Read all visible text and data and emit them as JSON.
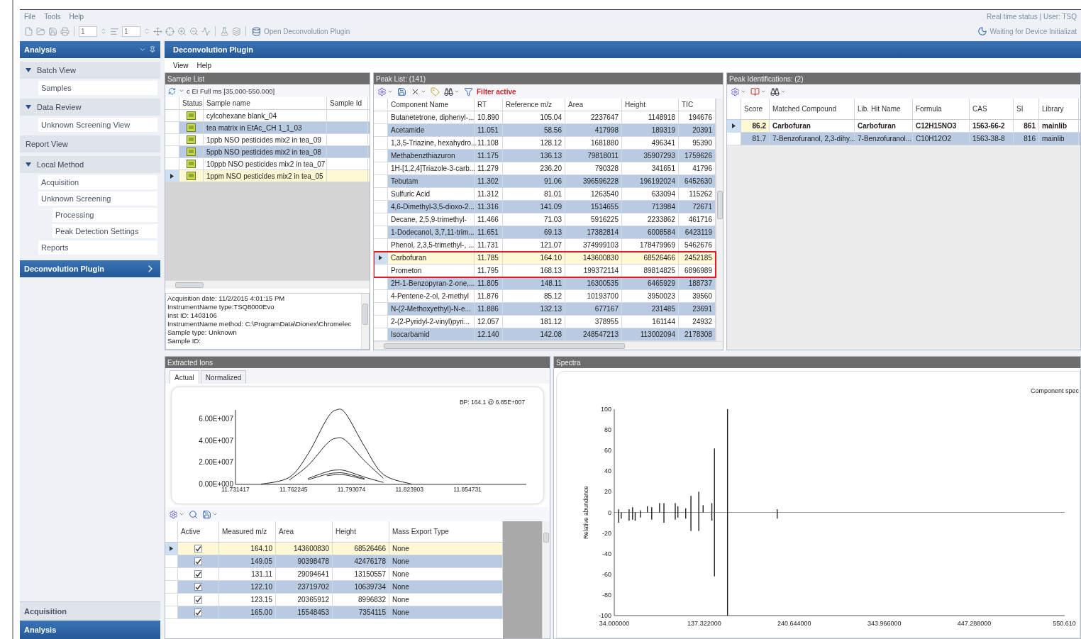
{
  "menu": [
    "File",
    "Tools",
    "Help"
  ],
  "status": {
    "text": "Real time status | User: TSQ",
    "device": "Waiting for Device Initializat"
  },
  "toolbar": {
    "spinners": [
      "1",
      "1"
    ],
    "plugin_button": "Open Deconvolution Plugin"
  },
  "sidebar": {
    "title": "Analysis",
    "items": [
      {
        "label": "Batch View",
        "expanded": true,
        "children": [
          {
            "label": "Samples"
          }
        ]
      },
      {
        "label": "Data Review",
        "expanded": true,
        "children": [
          {
            "label": "Unknown Screening View"
          }
        ]
      },
      {
        "label": "Report View"
      },
      {
        "label": "Local Method",
        "expanded": true,
        "children": [
          {
            "label": "Acquisition"
          },
          {
            "label": "Unknown Screening",
            "children": [
              {
                "label": "Processing"
              },
              {
                "label": "Peak Detection Settings"
              }
            ]
          },
          {
            "label": "Reports"
          }
        ]
      }
    ],
    "plugin_bar": "Deconvolution Plugin",
    "bottom_nav": [
      {
        "label": "Acquisition",
        "selected": false
      },
      {
        "label": "Analysis",
        "selected": true
      }
    ]
  },
  "plugin": {
    "title": "Deconvolution Plugin",
    "menu": [
      "View",
      "Help"
    ]
  },
  "sample_list": {
    "title": "Sample List",
    "scan_filter": "c EI Full ms [35.000-550.000]",
    "columns": [
      "Status",
      "Sample name",
      "Sample Id"
    ],
    "rows": [
      {
        "name": "cylcohexane blank_04",
        "selected": false
      },
      {
        "name": "tea matrix in EtAc_CH 1_1_03",
        "selected": false
      },
      {
        "name": "1ppb NSO pesticides mix2 in tea_09",
        "selected": false
      },
      {
        "name": "5ppb NSO pesticides mix2 in tea_08",
        "selected": false
      },
      {
        "name": "10ppb NSO pesticides mix2 in tea_07",
        "selected": false
      },
      {
        "name": "1ppm NSO pesticides mix2 in tea_05",
        "selected": true
      }
    ],
    "info": [
      "Acquisition date: 11/2/2015 4:01:15 PM",
      "InstrumentName type:TSQ8000Evo",
      "Inst ID: 1403106",
      "InstrumentName method: C:\\ProgramData\\Dionex\\Chromelec",
      "Sample type: Unknown",
      "Sample ID:"
    ]
  },
  "peak_list": {
    "title": "Peak List: (141)",
    "filter_status": "Filter active",
    "columns": [
      "Component Name",
      "RT",
      "Reference m/z",
      "Area",
      "Height",
      "TIC"
    ],
    "rows": [
      {
        "cells": [
          "Butanetetrone, diphenyl-...",
          "10.890",
          "105.04",
          "2237647",
          "1148918",
          "194676"
        ],
        "selected": false,
        "highlighted": false
      },
      {
        "cells": [
          "Acetamide",
          "11.051",
          "58.56",
          "417998",
          "189319",
          "20391"
        ],
        "selected": false,
        "highlighted": false
      },
      {
        "cells": [
          "1,3,5-Triazine, hexahydro...",
          "11.108",
          "128.12",
          "1681880",
          "496341",
          "95390"
        ],
        "selected": false,
        "highlighted": false
      },
      {
        "cells": [
          "Methabenzthiazuron",
          "11.175",
          "136.13",
          "79818011",
          "35907293",
          "1759626"
        ],
        "selected": false,
        "highlighted": false
      },
      {
        "cells": [
          "1H-[1,2,4]Triazole-3-carb...",
          "11.279",
          "236.20",
          "790328",
          "341651",
          "41796"
        ],
        "selected": false,
        "highlighted": false
      },
      {
        "cells": [
          "Tebutam",
          "11.302",
          "91.06",
          "396596228",
          "196192024",
          "6452630"
        ],
        "selected": false,
        "highlighted": false
      },
      {
        "cells": [
          "Sulfuric Acid",
          "11.312",
          "81.01",
          "1263540",
          "633094",
          "115262"
        ],
        "selected": false,
        "highlighted": false
      },
      {
        "cells": [
          "4,6-Dimethyl-3,5-dioxo-2...",
          "11.316",
          "141.09",
          "1514655",
          "713984",
          "72671"
        ],
        "selected": false,
        "highlighted": false
      },
      {
        "cells": [
          "Decane, 2,5,9-trimethyl-",
          "11.466",
          "71.03",
          "5916225",
          "2233862",
          "461716"
        ],
        "selected": false,
        "highlighted": false
      },
      {
        "cells": [
          "1-Dodecanol, 3,7,11-trim...",
          "11.651",
          "69.13",
          "17382814",
          "6008584",
          "6423119"
        ],
        "selected": false,
        "highlighted": false
      },
      {
        "cells": [
          "Phenol, 2,3,5-trimethyl-, ...",
          "11.731",
          "121.07",
          "374999103",
          "178479969",
          "5462676"
        ],
        "selected": false,
        "highlighted": false
      },
      {
        "cells": [
          "Carbofuran",
          "11.785",
          "164.10",
          "143600830",
          "68526466",
          "2452185"
        ],
        "selected": true,
        "highlighted": true
      },
      {
        "cells": [
          "Prometon",
          "11.795",
          "168.13",
          "199372114",
          "89814825",
          "6896989"
        ],
        "selected": false,
        "highlighted": true
      },
      {
        "cells": [
          "2H-1-Benzopyran-2-one,...",
          "11.805",
          "148.11",
          "16300535",
          "6465929",
          "188737"
        ],
        "selected": false,
        "highlighted": false
      },
      {
        "cells": [
          "4-Pentene-2-ol, 2-methyl",
          "11.876",
          "85.12",
          "10193700",
          "3950023",
          "39560"
        ],
        "selected": false,
        "highlighted": false
      },
      {
        "cells": [
          "N-(2-Methoxyethyl)-N-e...",
          "11.886",
          "132.13",
          "677167",
          "231485",
          "23691"
        ],
        "selected": false,
        "highlighted": false
      },
      {
        "cells": [
          "2-(2-Pyridyl-2-vinyl)pyri...",
          "12.057",
          "181.12",
          "378955",
          "161144",
          "24932"
        ],
        "selected": false,
        "highlighted": false
      },
      {
        "cells": [
          "Isocarbamid",
          "12.140",
          "142.08",
          "248547213",
          "113002094",
          "2178308"
        ],
        "selected": false,
        "highlighted": false
      }
    ]
  },
  "peak_identifications": {
    "title": "Peak Identifications: (2)",
    "columns": [
      "Score",
      "Matched Compound",
      "Lib. Hit Name",
      "Formula",
      "CAS",
      "SI",
      "Library"
    ],
    "rows": [
      {
        "cells": [
          "86.2",
          "Carbofuran",
          "Carbofuran",
          "C12H15NO3",
          "1563-66-2",
          "861",
          "mainlib"
        ],
        "selected": true
      },
      {
        "cells": [
          "81.7",
          "7-Benzofuranol, 2,3-dihy...",
          "7-Benzofuranol...",
          "C10H12O2",
          "1563-38-8",
          "816",
          "mainlib"
        ],
        "selected": false
      }
    ]
  },
  "extracted_ions": {
    "title": "Extracted Ions",
    "tabs": [
      {
        "label": "Actual",
        "selected": true
      },
      {
        "label": "Normalized",
        "selected": false
      }
    ],
    "base_peak": "BP: 164.1 @ 6.85E+007",
    "chart_data": {
      "type": "line",
      "x": [
        11.745,
        11.76,
        11.77,
        11.78,
        11.785,
        11.79,
        11.8,
        11.81,
        11.825
      ],
      "series": [
        {
          "values": [
            200000,
            6500000,
            28100000,
            60300000,
            68500000,
            65100000,
            34900000,
            9200000,
            300000
          ]
        },
        {
          "values": [
            null,
            4000000,
            17400000,
            37400000,
            42500000,
            40400000,
            21700000,
            5700000,
            null
          ]
        },
        {
          "values": [
            null,
            null,
            5400000,
            11600000,
            13200000,
            12500000,
            6700000,
            1800000,
            null
          ]
        },
        {
          "values": [
            null,
            null,
            4300000,
            9300000,
            10600000,
            10100000,
            5400000,
            null,
            null
          ]
        },
        {
          "values": [
            null,
            null,
            null,
            7900000,
            9000000,
            8600000,
            4600000,
            null,
            null
          ]
        }
      ],
      "xlim": [
        11.731417,
        11.886
      ],
      "ylim": [
        0,
        68500000
      ],
      "xticks": [
        {
          "value": 11.731417,
          "label": "11.731417"
        },
        {
          "value": 11.762245,
          "label": "11.762245"
        },
        {
          "value": 11.793074,
          "label": "11.793074"
        },
        {
          "value": 11.823903,
          "label": "11.823903"
        },
        {
          "value": 11.854731,
          "label": "11.854731"
        }
      ],
      "yticks": [
        {
          "value": 0,
          "label": "0.00E+000"
        },
        {
          "value": 20000000,
          "label": "2.00E+007"
        },
        {
          "value": 40000000,
          "label": "4.00E+007"
        },
        {
          "value": 60000000,
          "label": "6.00E+007"
        }
      ]
    },
    "table": {
      "active_column": "Active",
      "columns": [
        "Measured m/z",
        "Area",
        "Height",
        "Mass Export Type"
      ],
      "rows": [
        {
          "active": true,
          "cells": [
            "164.10",
            "143600830",
            "68526466",
            "None"
          ],
          "selected": true
        },
        {
          "active": true,
          "cells": [
            "149.05",
            "90398478",
            "42476178",
            "None"
          ],
          "selected": false
        },
        {
          "active": true,
          "cells": [
            "131.11",
            "29094641",
            "13150557",
            "None"
          ],
          "selected": false
        },
        {
          "active": true,
          "cells": [
            "122.10",
            "23719702",
            "10639734",
            "None"
          ],
          "selected": false
        },
        {
          "active": true,
          "cells": [
            "123.15",
            "20365912",
            "8996832",
            "None"
          ],
          "selected": false
        },
        {
          "active": true,
          "cells": [
            "165.00",
            "15548453",
            "7354115",
            "None"
          ],
          "selected": false
        }
      ]
    }
  },
  "spectra": {
    "title": "Spectra",
    "chart_data": {
      "type": "bar",
      "title": "Component spec",
      "ylabel": "Relative abundance",
      "x": [
        39,
        42,
        51,
        55,
        58,
        64,
        72,
        77,
        86,
        91,
        104,
        107,
        116,
        122,
        131,
        136,
        146,
        149,
        164,
        221
      ],
      "series": [
        {
          "values": [
            3,
            null,
            3,
            5,
            null,
            2,
            6,
            5,
            9,
            9,
            9,
            6,
            4,
            16,
            20,
            7,
            9,
            62,
            100,
            3
          ]
        },
        {
          "values": [
            -10,
            -6,
            -8,
            -7,
            -8,
            -5,
            null,
            -7,
            null,
            -10,
            -7,
            -5,
            -6,
            -18,
            -18,
            null,
            -8,
            -62,
            -100,
            -6
          ]
        }
      ],
      "xlim": [
        34,
        551
      ],
      "ylim": [
        -100,
        100
      ],
      "xticks": [
        {
          "value": 34,
          "label": "34.000000"
        },
        {
          "value": 137.322,
          "label": "137.322000"
        },
        {
          "value": 240.644,
          "label": "240.644000"
        },
        {
          "value": 343.966,
          "label": "343.966000"
        },
        {
          "value": 447.288,
          "label": "447.288000"
        },
        {
          "value": 550.61,
          "label": "550.610"
        }
      ],
      "yticks": [
        -100,
        -80,
        -60,
        -40,
        -20,
        0,
        20,
        40,
        60,
        80,
        100
      ]
    }
  }
}
